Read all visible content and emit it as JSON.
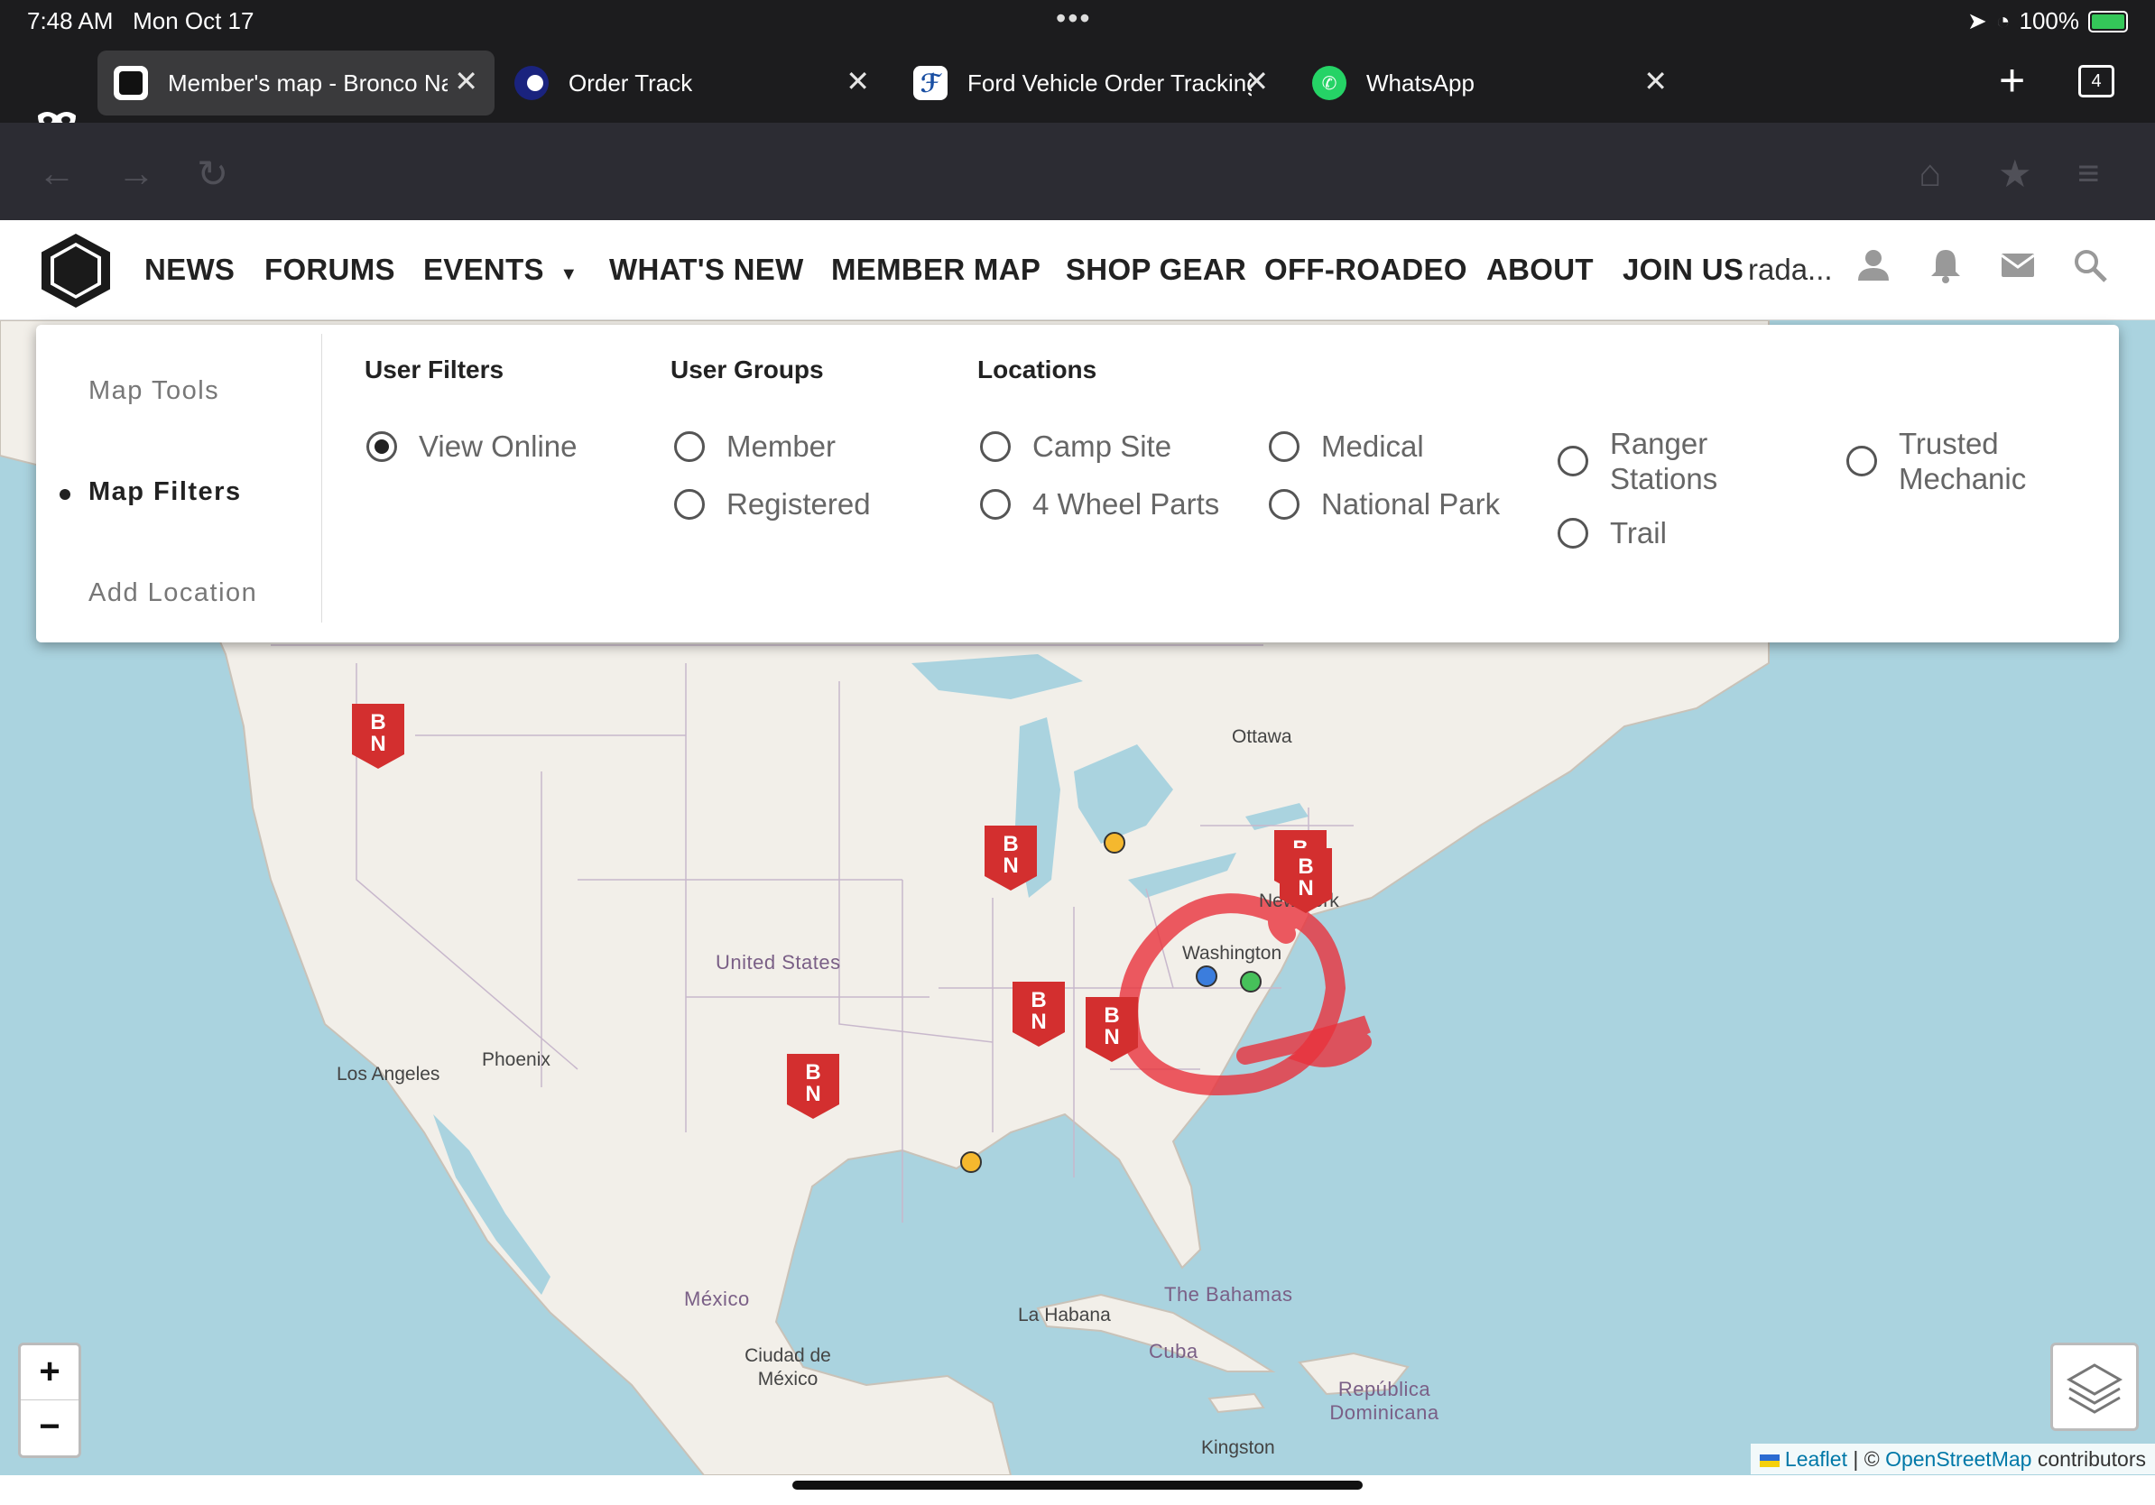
{
  "status_bar": {
    "time": "7:48 AM",
    "date": "Mon Oct 17",
    "battery": "100%"
  },
  "tabs": [
    {
      "title": "Member's map - Bronco Na",
      "icon": "bronco-nation-favicon",
      "active": true
    },
    {
      "title": "Order Track",
      "icon": "moon-favicon",
      "active": false
    },
    {
      "title": "Ford Vehicle Order Tracking",
      "icon": "ford-favicon",
      "active": false
    },
    {
      "title": "WhatsApp",
      "icon": "whatsapp-favicon",
      "active": false
    }
  ],
  "tab_count": "4",
  "toolbar": {
    "icons": [
      "back-icon",
      "forward-icon",
      "reload-icon",
      "home-icon",
      "bookmark-icon",
      "menu-icon"
    ]
  },
  "site_nav": {
    "items": [
      "NEWS",
      "FORUMS",
      "EVENTS",
      "WHAT'S NEW",
      "MEMBER MAP",
      "SHOP GEAR",
      "OFF-ROADEO",
      "ABOUT",
      "JOIN US"
    ],
    "events_caret": "▼",
    "user": "rada...",
    "icons": [
      "user-icon",
      "bell-icon",
      "mail-icon",
      "search-icon"
    ]
  },
  "panel": {
    "sidebar": [
      "Map Tools",
      "Map Filters",
      "Add Location"
    ],
    "active_sidebar": "Map Filters",
    "user_filters": {
      "heading": "User Filters",
      "options": [
        "View Online"
      ],
      "selected": "View Online"
    },
    "user_groups": {
      "heading": "User Groups",
      "options": [
        "Member",
        "Registered"
      ]
    },
    "locations": {
      "heading": "Locations",
      "options": [
        "Camp Site",
        "4 Wheel Parts",
        "Medical",
        "National Park",
        "Ranger Stations",
        "Trail",
        "Trusted Mechanic"
      ]
    }
  },
  "map": {
    "labels": {
      "ottawa": "Ottawa",
      "new_york": "New York",
      "washington": "Washington",
      "united_states": "United States",
      "phoenix": "Phoenix",
      "los_angeles": "Los Angeles",
      "mexico": "México",
      "ciudad": "Ciudad de México",
      "la_habana": "La Habana",
      "bahamas": "The Bahamas",
      "cuba": "Cuba",
      "republica": "República Dominicana",
      "kingston": "Kingston"
    },
    "marker_text": "BN",
    "zoom_in": "+",
    "zoom_out": "−",
    "attribution": {
      "leaflet": "Leaflet",
      "sep": " | © ",
      "osm": "OpenStreetMap",
      "suffix": " contributors"
    },
    "colors": {
      "marker": "#d32f2f",
      "dot_orange": "#f5b82e",
      "dot_blue": "#3b7ddd",
      "dot_green": "#46c15a",
      "annotation": "#e8323c"
    }
  }
}
